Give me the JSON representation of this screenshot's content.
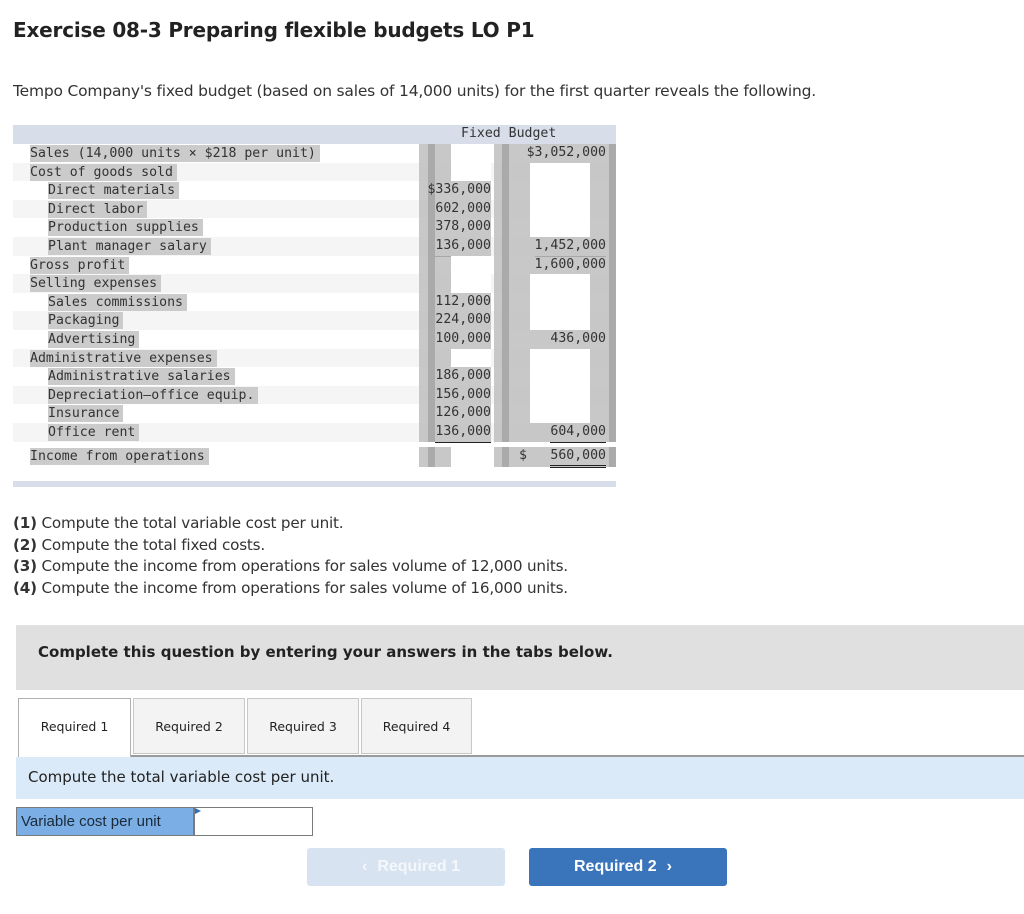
{
  "title": "Exercise 08-3 Preparing flexible budgets LO P1",
  "intro": "Tempo Company's fixed budget (based on sales of 14,000 units) for the first quarter reveals the following.",
  "budget": {
    "header": "Fixed Budget",
    "rows": [
      {
        "label": "Sales (14,000 units × $218 per unit)",
        "indent": 0,
        "col1": "",
        "col2": "$3,052,000"
      },
      {
        "label": "Cost of goods sold",
        "indent": 0,
        "col1": "",
        "col2": ""
      },
      {
        "label": "Direct materials",
        "indent": 1,
        "col1": "$336,000",
        "col2": ""
      },
      {
        "label": "Direct labor",
        "indent": 1,
        "col1": "602,000",
        "col2": ""
      },
      {
        "label": "Production supplies",
        "indent": 1,
        "col1": "378,000",
        "col2": ""
      },
      {
        "label": "Plant manager salary",
        "indent": 1,
        "col1": "136,000",
        "col2": "1,452,000"
      },
      {
        "label": "Gross profit",
        "indent": 0,
        "col1": "",
        "col2": "1,600,000"
      },
      {
        "label": "Selling expenses",
        "indent": 0,
        "col1": "",
        "col2": ""
      },
      {
        "label": "Sales commissions",
        "indent": 1,
        "col1": "112,000",
        "col2": ""
      },
      {
        "label": "Packaging",
        "indent": 1,
        "col1": "224,000",
        "col2": ""
      },
      {
        "label": "Advertising",
        "indent": 1,
        "col1": "100,000",
        "col2": "436,000"
      },
      {
        "label": "Administrative expenses",
        "indent": 0,
        "col1": "",
        "col2": ""
      },
      {
        "label": "Administrative salaries",
        "indent": 1,
        "col1": "186,000",
        "col2": ""
      },
      {
        "label": "Depreciation—office equip.",
        "indent": 1,
        "col1": "156,000",
        "col2": ""
      },
      {
        "label": "Insurance",
        "indent": 1,
        "col1": "126,000",
        "col2": ""
      },
      {
        "label": "Office rent",
        "indent": 1,
        "col1": "136,000",
        "col2": "604,000"
      }
    ],
    "total": {
      "label": "Income from operations",
      "currency": "$",
      "value": "560,000"
    }
  },
  "requirements": [
    {
      "num": "(1)",
      "text": " Compute the total variable cost per unit."
    },
    {
      "num": "(2)",
      "text": " Compute the total fixed costs."
    },
    {
      "num": "(3)",
      "text": " Compute the income from operations for sales volume of 12,000 units."
    },
    {
      "num": "(4)",
      "text": " Compute the income from operations for sales volume of 16,000 units."
    }
  ],
  "banner": "Complete this question by entering your answers in the tabs below.",
  "tabs": [
    {
      "label": "Required 1",
      "active": true
    },
    {
      "label": "Required 2",
      "active": false
    },
    {
      "label": "Required 3",
      "active": false
    },
    {
      "label": "Required 4",
      "active": false
    }
  ],
  "prompt": "Compute the total variable cost per unit.",
  "answer": {
    "label": "Variable cost per unit",
    "value": "",
    "placeholder": ""
  },
  "nav": {
    "prev": {
      "label": "Required 1",
      "chevron": "‹",
      "disabled": true
    },
    "next": {
      "label": "Required 2",
      "chevron": "›",
      "disabled": false
    }
  },
  "colors": {
    "nav_active": "#3a75bb",
    "nav_disabled": "#d7e3f0",
    "prompt_bg": "#daeaf8",
    "answer_label_bg": "#7aaee4",
    "banner_bg": "#e0e0e0"
  }
}
